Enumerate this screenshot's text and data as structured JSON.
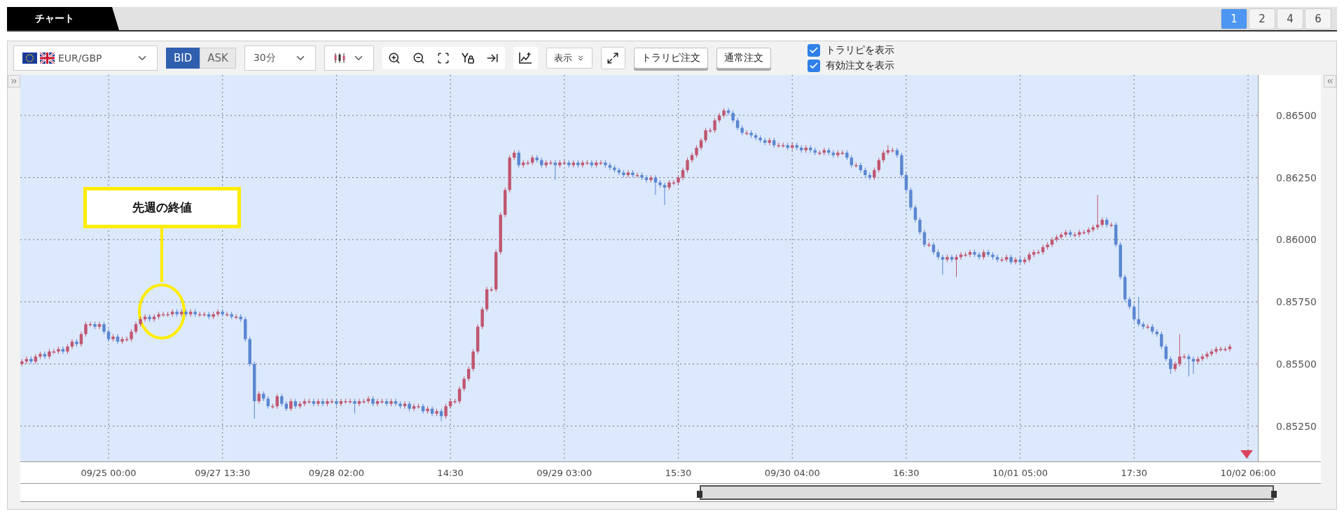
{
  "tab": {
    "label": "チャート"
  },
  "layout_buttons": [
    {
      "label": "1",
      "selected": true
    },
    {
      "label": "2",
      "selected": false
    },
    {
      "label": "4",
      "selected": false
    },
    {
      "label": "6",
      "selected": false
    }
  ],
  "toolbar": {
    "pair": {
      "value": "EUR/GBP"
    },
    "price_side": [
      {
        "label": "BID",
        "selected": true
      },
      {
        "label": "ASK",
        "selected": false
      }
    ],
    "timeframe": {
      "value": "30分"
    },
    "display_menu": {
      "label": "表示"
    },
    "order_buttons": [
      "トラリピ注文",
      "通常注文"
    ],
    "checkboxes": [
      {
        "label": "トラリピを表示",
        "checked": true
      },
      {
        "label": "有効注文を表示",
        "checked": true
      }
    ]
  },
  "chart": {
    "annotation": {
      "label": "先週の終値"
    },
    "chart_data": {
      "type": "candlestick",
      "grid": true,
      "ylim": [
        0.85108,
        0.86663
      ],
      "yticks": [
        {
          "value": 0.865,
          "label": "0.86500"
        },
        {
          "value": 0.8625,
          "label": "0.86250"
        },
        {
          "value": 0.86,
          "label": "0.86000"
        },
        {
          "value": 0.8575,
          "label": "0.85750"
        },
        {
          "value": 0.855,
          "label": "0.85500"
        },
        {
          "value": 0.8525,
          "label": "0.85250"
        }
      ],
      "categories": [
        null,
        null,
        null,
        null,
        null,
        null,
        null,
        null,
        null,
        null,
        null,
        null,
        null,
        null,
        null,
        null,
        null,
        null,
        null,
        "09/25 00:00",
        null,
        null,
        null,
        null,
        null,
        null,
        null,
        null,
        null,
        null,
        null,
        null,
        null,
        null,
        null,
        null,
        null,
        null,
        null,
        null,
        null,
        null,
        null,
        null,
        "09/27 13:30",
        null,
        null,
        null,
        null,
        null,
        null,
        null,
        null,
        null,
        null,
        null,
        null,
        null,
        null,
        null,
        null,
        null,
        null,
        null,
        null,
        null,
        null,
        null,
        null,
        "09/28 02:00",
        null,
        null,
        null,
        null,
        null,
        null,
        null,
        null,
        null,
        null,
        null,
        null,
        null,
        null,
        null,
        null,
        null,
        null,
        null,
        null,
        null,
        null,
        null,
        null,
        "14:30",
        null,
        null,
        null,
        null,
        null,
        null,
        null,
        null,
        null,
        null,
        null,
        null,
        null,
        null,
        null,
        null,
        null,
        null,
        null,
        null,
        null,
        null,
        null,
        null,
        "09/29 03:00",
        null,
        null,
        null,
        null,
        null,
        null,
        null,
        null,
        null,
        null,
        null,
        null,
        null,
        null,
        null,
        null,
        null,
        null,
        null,
        null,
        null,
        null,
        null,
        null,
        "15:30",
        null,
        null,
        null,
        null,
        null,
        null,
        null,
        null,
        null,
        null,
        null,
        null,
        null,
        null,
        null,
        null,
        null,
        null,
        null,
        null,
        null,
        null,
        null,
        null,
        "09/30 04:00",
        null,
        null,
        null,
        null,
        null,
        null,
        null,
        null,
        null,
        null,
        null,
        null,
        null,
        null,
        null,
        null,
        null,
        null,
        null,
        null,
        null,
        null,
        null,
        null,
        "16:30",
        null,
        null,
        null,
        null,
        null,
        null,
        null,
        null,
        null,
        null,
        null,
        null,
        null,
        null,
        null,
        null,
        null,
        null,
        null,
        null,
        null,
        null,
        null,
        null,
        "10/01 05:00",
        null,
        null,
        null,
        null,
        null,
        null,
        null,
        null,
        null,
        null,
        null,
        null,
        null,
        null,
        null,
        null,
        null,
        null,
        null,
        null,
        null,
        null,
        null,
        null,
        "17:30",
        null,
        null,
        null,
        null,
        null,
        null,
        null,
        null,
        null,
        null,
        null,
        null,
        null,
        null,
        null,
        null,
        null,
        null,
        null,
        null,
        null,
        null,
        null,
        null,
        "10/02 06:00"
      ],
      "ohlc": [
        [
          0.855,
          0.8552,
          0.8549,
          0.8551
        ],
        [
          0.8551,
          0.8553,
          0.855,
          0.8552
        ],
        [
          0.8552,
          0.8553,
          0.855,
          0.8551
        ],
        [
          0.8551,
          0.8554,
          0.855,
          0.8553
        ],
        [
          0.8553,
          0.8555,
          0.8552,
          0.8554
        ],
        [
          0.8554,
          0.8555,
          0.8552,
          0.8553
        ],
        [
          0.8553,
          0.8556,
          0.8552,
          0.8555
        ],
        [
          0.8555,
          0.8556,
          0.8554,
          0.8555
        ],
        [
          0.8555,
          0.8557,
          0.8554,
          0.8556
        ],
        [
          0.8556,
          0.8557,
          0.8554,
          0.8555
        ],
        [
          0.8555,
          0.8558,
          0.8554,
          0.8557
        ],
        [
          0.8557,
          0.856,
          0.8556,
          0.8559
        ],
        [
          0.8559,
          0.856,
          0.8557,
          0.8558
        ],
        [
          0.8558,
          0.8563,
          0.8557,
          0.8562
        ],
        [
          0.8562,
          0.8567,
          0.8561,
          0.8566
        ],
        [
          0.8566,
          0.8567,
          0.8565,
          0.8566
        ],
        [
          0.8566,
          0.8567,
          0.8564,
          0.8565
        ],
        [
          0.8565,
          0.8567,
          0.8564,
          0.8566
        ],
        [
          0.8566,
          0.8567,
          0.8562,
          0.8563
        ],
        [
          0.8563,
          0.8564,
          0.8559,
          0.856
        ],
        [
          0.856,
          0.8562,
          0.8559,
          0.8561
        ],
        [
          0.8561,
          0.8562,
          0.8558,
          0.8559
        ],
        [
          0.8559,
          0.8561,
          0.8558,
          0.856
        ],
        [
          0.856,
          0.8561,
          0.8559,
          0.856
        ],
        [
          0.856,
          0.8564,
          0.8559,
          0.8563
        ],
        [
          0.8563,
          0.8567,
          0.8562,
          0.8566
        ],
        [
          0.8566,
          0.8569,
          0.8565,
          0.8568
        ],
        [
          0.8568,
          0.857,
          0.8567,
          0.8569
        ],
        [
          0.8569,
          0.857,
          0.8567,
          0.8568
        ],
        [
          0.8568,
          0.857,
          0.8567,
          0.8569
        ],
        [
          0.8569,
          0.8571,
          0.8568,
          0.857
        ],
        [
          0.857,
          0.8571,
          0.8569,
          0.857
        ],
        [
          0.857,
          0.8571,
          0.8569,
          0.857
        ],
        [
          0.857,
          0.8572,
          0.8569,
          0.8571
        ],
        [
          0.8571,
          0.8572,
          0.8569,
          0.857
        ],
        [
          0.857,
          0.8572,
          0.8569,
          0.8571
        ],
        [
          0.8571,
          0.8572,
          0.8569,
          0.857
        ],
        [
          0.857,
          0.8572,
          0.8569,
          0.8571
        ],
        [
          0.8571,
          0.8572,
          0.8569,
          0.857
        ],
        [
          0.857,
          0.8571,
          0.8569,
          0.857
        ],
        [
          0.857,
          0.8571,
          0.8569,
          0.857
        ],
        [
          0.857,
          0.8571,
          0.8568,
          0.8569
        ],
        [
          0.8569,
          0.8571,
          0.8568,
          0.857
        ],
        [
          0.857,
          0.8572,
          0.8569,
          0.8571
        ],
        [
          0.8571,
          0.8572,
          0.8569,
          0.857
        ],
        [
          0.857,
          0.8571,
          0.8569,
          0.857
        ],
        [
          0.857,
          0.8571,
          0.8568,
          0.8569
        ],
        [
          0.8569,
          0.857,
          0.8568,
          0.8569
        ],
        [
          0.8569,
          0.857,
          0.8567,
          0.8568
        ],
        [
          0.8568,
          0.8569,
          0.8559,
          0.856
        ],
        [
          0.856,
          0.8561,
          0.8549,
          0.855
        ],
        [
          0.855,
          0.8551,
          0.8528,
          0.8535
        ],
        [
          0.8535,
          0.8539,
          0.8534,
          0.8538
        ],
        [
          0.8538,
          0.8539,
          0.8535,
          0.8536
        ],
        [
          0.8536,
          0.8537,
          0.8532,
          0.8533
        ],
        [
          0.8533,
          0.8534,
          0.8532,
          0.8533
        ],
        [
          0.8533,
          0.8538,
          0.8532,
          0.8537
        ],
        [
          0.8537,
          0.8538,
          0.8533,
          0.8534
        ],
        [
          0.8534,
          0.8535,
          0.8531,
          0.8532
        ],
        [
          0.8532,
          0.8536,
          0.8531,
          0.8535
        ],
        [
          0.8535,
          0.8536,
          0.8532,
          0.8533
        ],
        [
          0.8533,
          0.8535,
          0.8532,
          0.8534
        ],
        [
          0.8534,
          0.8536,
          0.8533,
          0.8535
        ],
        [
          0.8535,
          0.8536,
          0.8534,
          0.8535
        ],
        [
          0.8535,
          0.8536,
          0.8533,
          0.8534
        ],
        [
          0.8534,
          0.8536,
          0.8533,
          0.8535
        ],
        [
          0.8535,
          0.8536,
          0.8533,
          0.8534
        ],
        [
          0.8534,
          0.8536,
          0.8533,
          0.8535
        ],
        [
          0.8535,
          0.8536,
          0.8534,
          0.8535
        ],
        [
          0.8535,
          0.8536,
          0.8533,
          0.8534
        ],
        [
          0.8534,
          0.8536,
          0.8533,
          0.8535
        ],
        [
          0.8535,
          0.8536,
          0.8534,
          0.8535
        ],
        [
          0.8535,
          0.8536,
          0.8534,
          0.8535
        ],
        [
          0.8535,
          0.8536,
          0.853,
          0.8534
        ],
        [
          0.8534,
          0.8536,
          0.8533,
          0.8535
        ],
        [
          0.8535,
          0.8536,
          0.8534,
          0.8535
        ],
        [
          0.8535,
          0.8537,
          0.8534,
          0.8536
        ],
        [
          0.8536,
          0.8537,
          0.8533,
          0.8534
        ],
        [
          0.8534,
          0.8536,
          0.8533,
          0.8535
        ],
        [
          0.8535,
          0.8536,
          0.8534,
          0.8535
        ],
        [
          0.8535,
          0.8536,
          0.8533,
          0.8534
        ],
        [
          0.8534,
          0.8536,
          0.8533,
          0.8535
        ],
        [
          0.8535,
          0.8536,
          0.8533,
          0.8534
        ],
        [
          0.8534,
          0.8535,
          0.8532,
          0.8533
        ],
        [
          0.8533,
          0.8535,
          0.8532,
          0.8534
        ],
        [
          0.8534,
          0.8535,
          0.8531,
          0.8532
        ],
        [
          0.8532,
          0.8534,
          0.8531,
          0.8533
        ],
        [
          0.8533,
          0.8534,
          0.8532,
          0.8533
        ],
        [
          0.8533,
          0.8534,
          0.853,
          0.8531
        ],
        [
          0.8531,
          0.8533,
          0.853,
          0.8532
        ],
        [
          0.8532,
          0.8533,
          0.8529,
          0.853
        ],
        [
          0.853,
          0.8532,
          0.8529,
          0.8531
        ],
        [
          0.8531,
          0.8532,
          0.8527,
          0.8529
        ],
        [
          0.8529,
          0.8534,
          0.8528,
          0.8533
        ],
        [
          0.8533,
          0.8536,
          0.8532,
          0.8535
        ],
        [
          0.8535,
          0.8536,
          0.8534,
          0.8535
        ],
        [
          0.8535,
          0.8541,
          0.8534,
          0.854
        ],
        [
          0.854,
          0.8545,
          0.8539,
          0.8544
        ],
        [
          0.8544,
          0.8549,
          0.8543,
          0.8548
        ],
        [
          0.8548,
          0.8556,
          0.8547,
          0.8555
        ],
        [
          0.8555,
          0.8566,
          0.8554,
          0.8565
        ],
        [
          0.8565,
          0.8573,
          0.8564,
          0.8572
        ],
        [
          0.8572,
          0.8581,
          0.8571,
          0.858
        ],
        [
          0.858,
          0.8581,
          0.8579,
          0.858
        ],
        [
          0.858,
          0.8596,
          0.8579,
          0.8595
        ],
        [
          0.8595,
          0.8611,
          0.8594,
          0.861
        ],
        [
          0.861,
          0.8621,
          0.8609,
          0.862
        ],
        [
          0.862,
          0.8634,
          0.8619,
          0.8633
        ],
        [
          0.8633,
          0.8636,
          0.8632,
          0.8635
        ],
        [
          0.8635,
          0.8636,
          0.8629,
          0.863
        ],
        [
          0.863,
          0.8632,
          0.8629,
          0.8631
        ],
        [
          0.8631,
          0.8632,
          0.863,
          0.8631
        ],
        [
          0.8631,
          0.8634,
          0.863,
          0.8633
        ],
        [
          0.8633,
          0.8634,
          0.8631,
          0.8632
        ],
        [
          0.8632,
          0.8633,
          0.8629,
          0.863
        ],
        [
          0.863,
          0.8632,
          0.8629,
          0.8631
        ],
        [
          0.8631,
          0.8632,
          0.863,
          0.8631
        ],
        [
          0.8631,
          0.8632,
          0.8624,
          0.863
        ],
        [
          0.863,
          0.8632,
          0.8629,
          0.8631
        ],
        [
          0.8631,
          0.8632,
          0.863,
          0.8631
        ],
        [
          0.8631,
          0.8632,
          0.8629,
          0.863
        ],
        [
          0.863,
          0.8632,
          0.8629,
          0.8631
        ],
        [
          0.8631,
          0.8632,
          0.8629,
          0.863
        ],
        [
          0.863,
          0.8632,
          0.8629,
          0.8631
        ],
        [
          0.8631,
          0.8632,
          0.863,
          0.8631
        ],
        [
          0.8631,
          0.8632,
          0.8629,
          0.863
        ],
        [
          0.863,
          0.8632,
          0.8629,
          0.8631
        ],
        [
          0.8631,
          0.8632,
          0.863,
          0.8631
        ],
        [
          0.8631,
          0.8632,
          0.8629,
          0.863
        ],
        [
          0.863,
          0.8631,
          0.8628,
          0.8629
        ],
        [
          0.8629,
          0.863,
          0.8627,
          0.8628
        ],
        [
          0.8628,
          0.8629,
          0.8626,
          0.8627
        ],
        [
          0.8627,
          0.8628,
          0.8625,
          0.8626
        ],
        [
          0.8626,
          0.8628,
          0.8625,
          0.8627
        ],
        [
          0.8627,
          0.8628,
          0.8625,
          0.8626
        ],
        [
          0.8626,
          0.8627,
          0.8625,
          0.8626
        ],
        [
          0.8626,
          0.8627,
          0.8624,
          0.8625
        ],
        [
          0.8625,
          0.8626,
          0.8623,
          0.8624
        ],
        [
          0.8624,
          0.8626,
          0.8623,
          0.8625
        ],
        [
          0.8625,
          0.8626,
          0.8618,
          0.8623
        ],
        [
          0.8623,
          0.8624,
          0.8621,
          0.8622
        ],
        [
          0.8622,
          0.8623,
          0.8614,
          0.8621
        ],
        [
          0.8621,
          0.8624,
          0.862,
          0.8623
        ],
        [
          0.8623,
          0.8624,
          0.8622,
          0.8623
        ],
        [
          0.8623,
          0.8626,
          0.8622,
          0.8625
        ],
        [
          0.8625,
          0.8629,
          0.8624,
          0.8628
        ],
        [
          0.8628,
          0.8633,
          0.8627,
          0.8632
        ],
        [
          0.8632,
          0.8635,
          0.8631,
          0.8634
        ],
        [
          0.8634,
          0.8638,
          0.8633,
          0.8637
        ],
        [
          0.8637,
          0.8641,
          0.8636,
          0.864
        ],
        [
          0.864,
          0.8645,
          0.8639,
          0.8644
        ],
        [
          0.8644,
          0.8645,
          0.8643,
          0.8644
        ],
        [
          0.8644,
          0.8649,
          0.8643,
          0.8648
        ],
        [
          0.8648,
          0.8651,
          0.8647,
          0.865
        ],
        [
          0.865,
          0.8653,
          0.8649,
          0.8652
        ],
        [
          0.8652,
          0.8653,
          0.865,
          0.8651
        ],
        [
          0.8651,
          0.8652,
          0.8647,
          0.8648
        ],
        [
          0.8648,
          0.8649,
          0.8644,
          0.8645
        ],
        [
          0.8645,
          0.8646,
          0.8642,
          0.8643
        ],
        [
          0.8643,
          0.8644,
          0.8642,
          0.8643
        ],
        [
          0.8643,
          0.8644,
          0.8641,
          0.8642
        ],
        [
          0.8642,
          0.8643,
          0.864,
          0.8641
        ],
        [
          0.8641,
          0.8642,
          0.8639,
          0.864
        ],
        [
          0.864,
          0.8641,
          0.8638,
          0.8639
        ],
        [
          0.8639,
          0.8641,
          0.8638,
          0.864
        ],
        [
          0.864,
          0.8641,
          0.8637,
          0.8638
        ],
        [
          0.8638,
          0.8639,
          0.8637,
          0.8638
        ],
        [
          0.8638,
          0.8639,
          0.8637,
          0.8638
        ],
        [
          0.8638,
          0.8639,
          0.8636,
          0.8637
        ],
        [
          0.8637,
          0.8639,
          0.8636,
          0.8638
        ],
        [
          0.8638,
          0.8639,
          0.8636,
          0.8637
        ],
        [
          0.8637,
          0.8638,
          0.8635,
          0.8636
        ],
        [
          0.8636,
          0.8638,
          0.8635,
          0.8637
        ],
        [
          0.8637,
          0.8638,
          0.8635,
          0.8636
        ],
        [
          0.8636,
          0.8637,
          0.8634,
          0.8635
        ],
        [
          0.8635,
          0.8636,
          0.8634,
          0.8635
        ],
        [
          0.8635,
          0.8637,
          0.8634,
          0.8636
        ],
        [
          0.8636,
          0.8637,
          0.8634,
          0.8635
        ],
        [
          0.8635,
          0.8636,
          0.8633,
          0.8634
        ],
        [
          0.8634,
          0.8636,
          0.8633,
          0.8635
        ],
        [
          0.8635,
          0.8636,
          0.8634,
          0.8635
        ],
        [
          0.8635,
          0.8636,
          0.8632,
          0.8633
        ],
        [
          0.8633,
          0.8634,
          0.8629,
          0.863
        ],
        [
          0.863,
          0.8631,
          0.8629,
          0.863
        ],
        [
          0.863,
          0.8631,
          0.8627,
          0.8628
        ],
        [
          0.8628,
          0.8629,
          0.8625,
          0.8626
        ],
        [
          0.8626,
          0.8627,
          0.8624,
          0.8625
        ],
        [
          0.8625,
          0.8629,
          0.8624,
          0.8628
        ],
        [
          0.8628,
          0.8633,
          0.8627,
          0.8632
        ],
        [
          0.8632,
          0.8636,
          0.8631,
          0.8635
        ],
        [
          0.8635,
          0.8638,
          0.8634,
          0.8636
        ],
        [
          0.8636,
          0.8637,
          0.8635,
          0.8636
        ],
        [
          0.8636,
          0.8637,
          0.8633,
          0.8634
        ],
        [
          0.8634,
          0.8635,
          0.8625,
          0.8626
        ],
        [
          0.8626,
          0.8627,
          0.8619,
          0.862
        ],
        [
          0.862,
          0.8621,
          0.8612,
          0.8613
        ],
        [
          0.8613,
          0.8614,
          0.8607,
          0.8608
        ],
        [
          0.8608,
          0.8609,
          0.8602,
          0.8603
        ],
        [
          0.8603,
          0.8604,
          0.8597,
          0.8598
        ],
        [
          0.8598,
          0.8599,
          0.8597,
          0.8598
        ],
        [
          0.8598,
          0.8599,
          0.8594,
          0.8595
        ],
        [
          0.8595,
          0.8596,
          0.8592,
          0.8593
        ],
        [
          0.8593,
          0.8594,
          0.8586,
          0.8592
        ],
        [
          0.8592,
          0.8594,
          0.8591,
          0.8593
        ],
        [
          0.8593,
          0.8594,
          0.8591,
          0.8592
        ],
        [
          0.8592,
          0.8594,
          0.8585,
          0.8593
        ],
        [
          0.8593,
          0.8595,
          0.8592,
          0.8594
        ],
        [
          0.8594,
          0.8595,
          0.8593,
          0.8594
        ],
        [
          0.8594,
          0.8596,
          0.8593,
          0.8595
        ],
        [
          0.8595,
          0.8596,
          0.8593,
          0.8594
        ],
        [
          0.8594,
          0.8595,
          0.8592,
          0.8593
        ],
        [
          0.8593,
          0.8596,
          0.8592,
          0.8595
        ],
        [
          0.8595,
          0.8596,
          0.8593,
          0.8594
        ],
        [
          0.8594,
          0.8595,
          0.8592,
          0.8593
        ],
        [
          0.8593,
          0.8594,
          0.8591,
          0.8592
        ],
        [
          0.8592,
          0.8593,
          0.8591,
          0.8592
        ],
        [
          0.8592,
          0.8594,
          0.8591,
          0.8593
        ],
        [
          0.8593,
          0.8594,
          0.859,
          0.8591
        ],
        [
          0.8591,
          0.8593,
          0.859,
          0.8592
        ],
        [
          0.8592,
          0.8593,
          0.859,
          0.8591
        ],
        [
          0.8591,
          0.8593,
          0.859,
          0.8592
        ],
        [
          0.8592,
          0.8595,
          0.8591,
          0.8594
        ],
        [
          0.8594,
          0.8596,
          0.8593,
          0.8595
        ],
        [
          0.8595,
          0.8596,
          0.8594,
          0.8595
        ],
        [
          0.8595,
          0.8598,
          0.8594,
          0.8597
        ],
        [
          0.8597,
          0.8599,
          0.8596,
          0.8598
        ],
        [
          0.8598,
          0.8601,
          0.8597,
          0.86
        ],
        [
          0.86,
          0.8602,
          0.8599,
          0.8601
        ],
        [
          0.8601,
          0.8603,
          0.86,
          0.8602
        ],
        [
          0.8602,
          0.8604,
          0.8601,
          0.8603
        ],
        [
          0.8603,
          0.8604,
          0.8601,
          0.8602
        ],
        [
          0.8602,
          0.8603,
          0.8601,
          0.8602
        ],
        [
          0.8602,
          0.8604,
          0.8601,
          0.8603
        ],
        [
          0.8603,
          0.8604,
          0.8602,
          0.8603
        ],
        [
          0.8603,
          0.8605,
          0.8602,
          0.8604
        ],
        [
          0.8604,
          0.8606,
          0.8603,
          0.8605
        ],
        [
          0.8605,
          0.8618,
          0.8604,
          0.8606
        ],
        [
          0.8606,
          0.8609,
          0.8605,
          0.8608
        ],
        [
          0.8608,
          0.8609,
          0.8605,
          0.8606
        ],
        [
          0.8606,
          0.8607,
          0.8605,
          0.8606
        ],
        [
          0.8606,
          0.8607,
          0.8597,
          0.8598
        ],
        [
          0.8598,
          0.8599,
          0.8584,
          0.8585
        ],
        [
          0.8585,
          0.8586,
          0.8575,
          0.8576
        ],
        [
          0.8576,
          0.8577,
          0.8572,
          0.8573
        ],
        [
          0.8573,
          0.8574,
          0.8567,
          0.8568
        ],
        [
          0.8568,
          0.8577,
          0.8565,
          0.8566
        ],
        [
          0.8566,
          0.8567,
          0.8564,
          0.8565
        ],
        [
          0.8565,
          0.8566,
          0.8564,
          0.8565
        ],
        [
          0.8565,
          0.8566,
          0.8562,
          0.8563
        ],
        [
          0.8563,
          0.8564,
          0.8561,
          0.8562
        ],
        [
          0.8562,
          0.8563,
          0.8556,
          0.8557
        ],
        [
          0.8557,
          0.8558,
          0.8551,
          0.8552
        ],
        [
          0.8552,
          0.8553,
          0.8546,
          0.8548
        ],
        [
          0.8548,
          0.8551,
          0.8547,
          0.855
        ],
        [
          0.855,
          0.8562,
          0.8549,
          0.8553
        ],
        [
          0.8553,
          0.8554,
          0.8552,
          0.8553
        ],
        [
          0.8553,
          0.8554,
          0.8545,
          0.8552
        ],
        [
          0.8552,
          0.8553,
          0.8546,
          0.8551
        ],
        [
          0.8551,
          0.8553,
          0.855,
          0.8552
        ],
        [
          0.8552,
          0.8554,
          0.8551,
          0.8553
        ],
        [
          0.8553,
          0.8555,
          0.8552,
          0.8554
        ],
        [
          0.8554,
          0.8556,
          0.8553,
          0.8555
        ],
        [
          0.8555,
          0.8557,
          0.8554,
          0.8556
        ],
        [
          0.8556,
          0.8557,
          0.8555,
          0.8556
        ],
        [
          0.8556,
          0.8557,
          0.8555,
          0.8556
        ],
        [
          0.8556,
          0.8558,
          0.8555,
          0.8557
        ],
        null,
        null,
        null,
        null
      ]
    }
  }
}
